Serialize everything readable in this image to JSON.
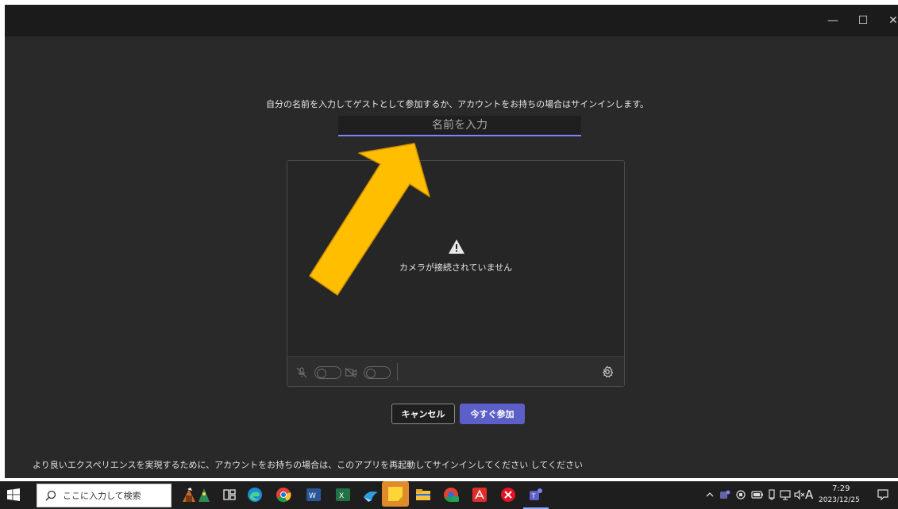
{
  "window": {
    "minimize": "—",
    "maximize": "☐",
    "close": "✕"
  },
  "prejoin": {
    "prompt": "自分の名前を入力してゲストとして参加するか、アカウントをお持ちの場合はサインインします。",
    "name_placeholder": "名前を入力",
    "camera_message": "カメラが接続されていません",
    "cancel_label": "キャンセル",
    "join_label": "今すぐ参加",
    "footer_message": "より良いエクスペリエンスを実現するために、アカウントをお持ちの場合は、このアプリを再起動してサインインしてください してください"
  },
  "taskbar": {
    "search_placeholder": "ここに入力して検索",
    "clock_time": "7:29",
    "clock_date": "2023/12/25",
    "ime_indicator": "A",
    "apps": [
      "holiday-widget",
      "task-view",
      "edge",
      "chrome",
      "word",
      "excel",
      "network-app",
      "sticky-notes",
      "file-explorer",
      "chrome-profile",
      "acrobat",
      "error-app",
      "teams"
    ]
  },
  "colors": {
    "accent": "#5b5fc7",
    "input_underline": "#7f85f5",
    "arrow": "#ffbf00",
    "background": "#292929"
  }
}
